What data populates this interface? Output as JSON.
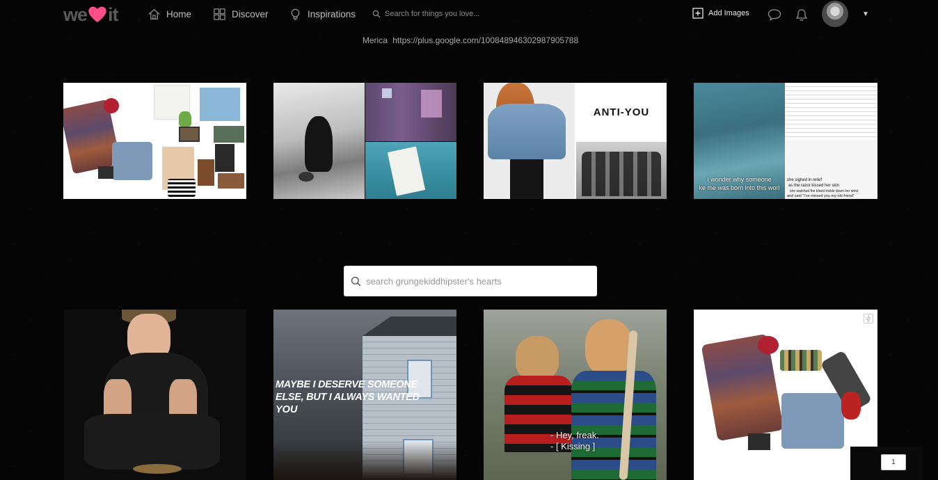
{
  "brand": {
    "logo_left": "we",
    "logo_right": "it",
    "accent": "#ff4f8b"
  },
  "nav": {
    "home": "Home",
    "discover": "Discover",
    "inspirations": "Inspirations",
    "search_placeholder": "Search for things you love..."
  },
  "actions": {
    "add_images": "Add Images"
  },
  "profile": {
    "location": "Merica",
    "url": "https://plus.google.com/100848946302987905788"
  },
  "tiles": {
    "anti_you": "ANTI-YOU",
    "wonder_1": "I wonder why someone",
    "wonder_2": "ke me was born into this worl",
    "relief_1": "she sighed in relief",
    "relief_2": "as the razor kissed her skin",
    "relief_3": "she watched the blood trickle down her wrist",
    "relief_4": "and said \"I've missed you my old friend\"",
    "maybe_1": "MAYBE I DESERVE SOMEONE",
    "maybe_2": "ELSE, BUT I ALWAYS WANTED",
    "maybe_3": "YOU",
    "sub_1": "- Hey, freak.",
    "sub_2": "- [ Kissing ]"
  },
  "hearts_search": {
    "placeholder": "search grungekiddhipster's hearts"
  },
  "pagination": {
    "current": "1"
  }
}
